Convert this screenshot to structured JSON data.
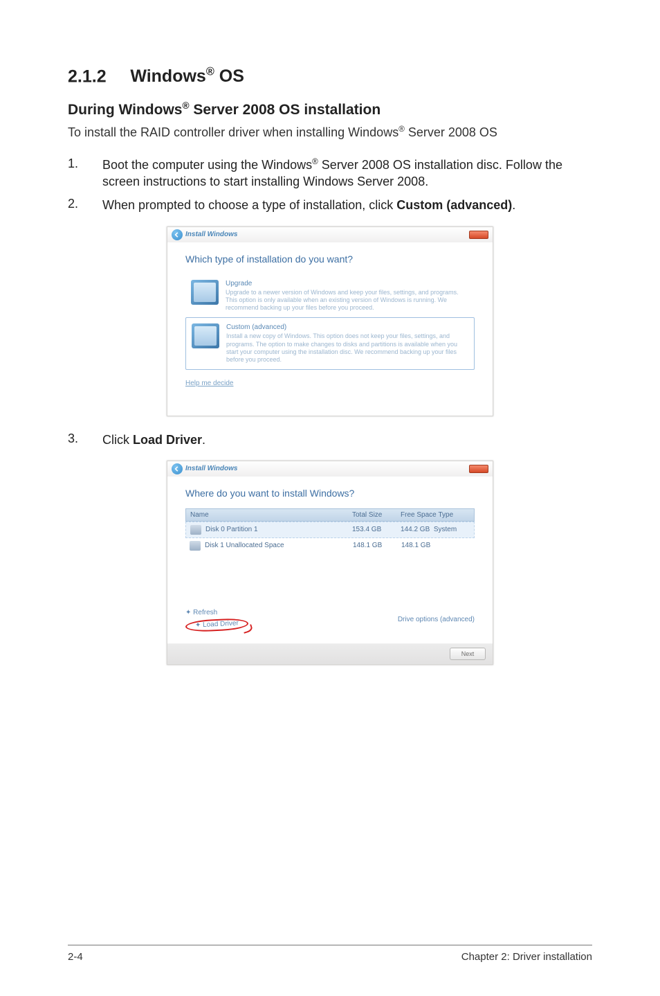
{
  "heading": {
    "num": "2.1.2",
    "title": "Windows® OS"
  },
  "subheading": "During Windows® Server 2008 OS installation",
  "intro": "To install the RAID controller driver when installing Windows® Server 2008 OS",
  "steps": [
    {
      "n": "1.",
      "text": "Boot the computer using the Windows® Server 2008 OS installation disc. Follow the screen instructions to start installing Windows Server 2008."
    },
    {
      "n": "2.",
      "text_pre": "When prompted to choose a type of installation, click ",
      "bold": "Custom (advanced)",
      "text_post": "."
    },
    {
      "n": "3.",
      "text_pre": "Click ",
      "bold": "Load Driver",
      "text_post": "."
    }
  ],
  "dialog1": {
    "caption": "Install Windows",
    "prompt": "Which type of installation do you want?",
    "opt1": {
      "title": "Upgrade",
      "desc": "Upgrade to a newer version of Windows and keep your files, settings, and programs. This option is only available when an existing version of Windows is running. We recommend backing up your files before you proceed."
    },
    "opt2": {
      "title": "Custom (advanced)",
      "desc": "Install a new copy of Windows. This option does not keep your files, settings, and programs. The option to make changes to disks and partitions is available when you start your computer using the installation disc. We recommend backing up your files before you proceed."
    },
    "help": "Help me decide"
  },
  "dialog2": {
    "caption": "Install Windows",
    "prompt": "Where do you want to install Windows?",
    "headers": {
      "name": "Name",
      "total": "Total Size",
      "free": "Free Space",
      "type": "Type"
    },
    "rows": [
      {
        "name": "Disk 0 Partition 1",
        "total": "153.4 GB",
        "free": "144.2 GB",
        "type": "System"
      },
      {
        "name": "Disk 1 Unallocated Space",
        "total": "148.1 GB",
        "free": "148.1 GB",
        "type": ""
      }
    ],
    "refresh": "Refresh",
    "load": "Load Driver",
    "adv": "Drive options (advanced)",
    "next": "Next"
  },
  "footer": {
    "left": "2-4",
    "right": "Chapter 2: Driver installation"
  }
}
